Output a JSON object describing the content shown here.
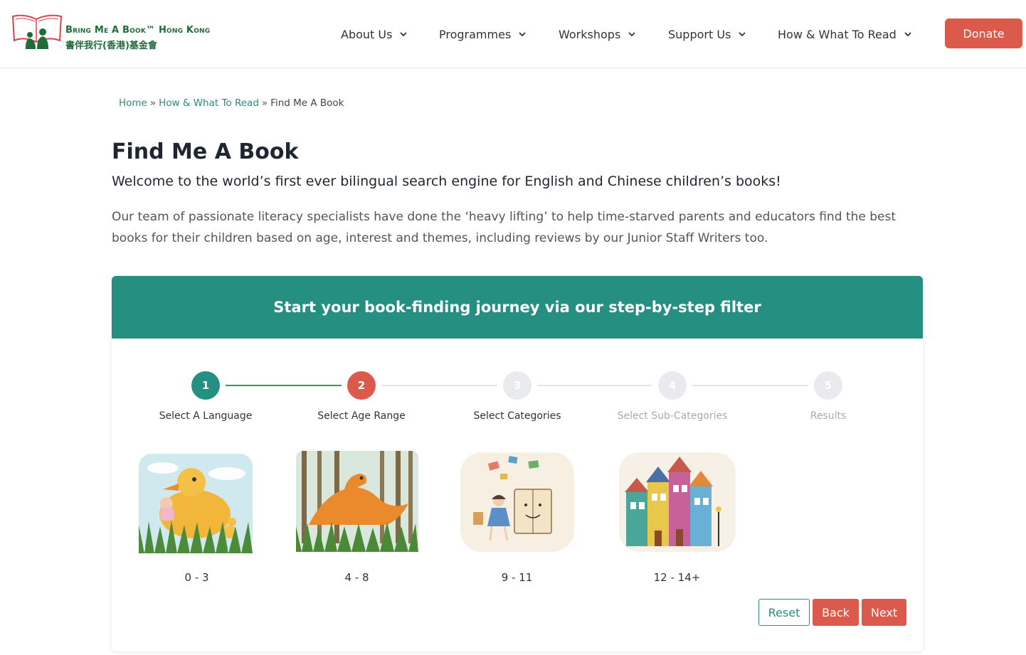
{
  "brand": {
    "name_en": "Bring Me A Book™ Hong Kong",
    "name_zh": "書伴我行(香港)基金會"
  },
  "nav": {
    "items": [
      {
        "label": "About Us"
      },
      {
        "label": "Programmes"
      },
      {
        "label": "Workshops"
      },
      {
        "label": "Support Us"
      },
      {
        "label": "How & What To Read"
      }
    ],
    "donate_label": "Donate"
  },
  "breadcrumb": {
    "home": "Home",
    "section": "How & What To Read",
    "current": "Find Me A Book",
    "separator": "»"
  },
  "page": {
    "title": "Find Me A Book",
    "subtitle": "Welcome to the world’s first ever bilingual search engine for English and Chinese children’s books!",
    "intro": "Our team of passionate literacy specialists have done the ‘heavy lifting’ to help time-starved parents and educators find the best books for their children based on age, interest and themes, including reviews by our Junior Staff Writers too."
  },
  "filter": {
    "heading": "Start your book-finding journey via our step-by-step filter",
    "steps": [
      {
        "number": "1",
        "label": "Select A Language",
        "state": "done"
      },
      {
        "number": "2",
        "label": "Select Age Range",
        "state": "active"
      },
      {
        "number": "3",
        "label": "Select Categories",
        "state": "todo"
      },
      {
        "number": "4",
        "label": "Select Sub-Categories",
        "state": "todo"
      },
      {
        "number": "5",
        "label": "Results",
        "state": "todo"
      }
    ],
    "age_ranges": [
      {
        "label": "0 - 3",
        "icon": "duckling-illustration"
      },
      {
        "label": "4 - 8",
        "icon": "dinosaur-illustration"
      },
      {
        "label": "9 - 11",
        "icon": "girl-and-book-illustration"
      },
      {
        "label": "12 - 14+",
        "icon": "houses-illustration"
      }
    ],
    "reset_label": "Reset",
    "back_label": "Back",
    "next_label": "Next"
  },
  "colors": {
    "teal": "#258f82",
    "coral": "#db5a4b",
    "brand_green": "#1f6b3a",
    "progress_green": "#2f9b55"
  }
}
